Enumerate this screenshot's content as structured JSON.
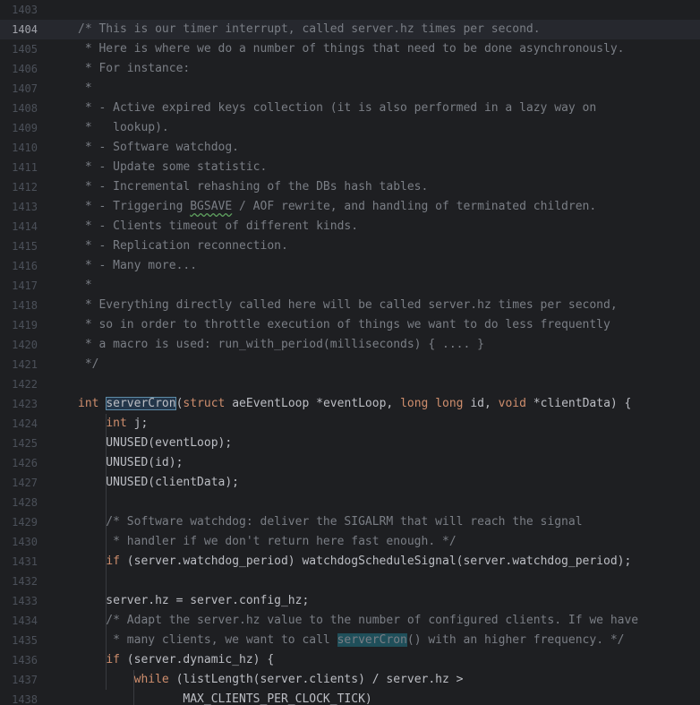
{
  "editor": {
    "current_line": "1404",
    "lines": [
      {
        "number": "1403",
        "tokens": []
      },
      {
        "number": "1404",
        "tokens": [
          {
            "t": "/* This is our timer interrupt, called server.hz times per second.",
            "c": "comment"
          }
        ]
      },
      {
        "number": "1405",
        "tokens": [
          {
            "t": " * Here is where we do a number of things that need to be done asynchronously.",
            "c": "comment"
          }
        ]
      },
      {
        "number": "1406",
        "tokens": [
          {
            "t": " * For instance:",
            "c": "comment"
          }
        ]
      },
      {
        "number": "1407",
        "tokens": [
          {
            "t": " *",
            "c": "comment"
          }
        ]
      },
      {
        "number": "1408",
        "tokens": [
          {
            "t": " * - Active expired keys collection (it is also performed in a lazy way on",
            "c": "comment"
          }
        ]
      },
      {
        "number": "1409",
        "tokens": [
          {
            "t": " *   lookup).",
            "c": "comment"
          }
        ]
      },
      {
        "number": "1410",
        "tokens": [
          {
            "t": " * - Software watchdog.",
            "c": "comment"
          }
        ]
      },
      {
        "number": "1411",
        "tokens": [
          {
            "t": " * - Update some statistic.",
            "c": "comment"
          }
        ]
      },
      {
        "number": "1412",
        "tokens": [
          {
            "t": " * - Incremental rehashing of the DBs hash tables.",
            "c": "comment"
          }
        ]
      },
      {
        "number": "1413",
        "tokens": [
          {
            "t": " * - Triggering ",
            "c": "comment"
          },
          {
            "t": "BGSAVE",
            "c": "comment warn"
          },
          {
            "t": " / AOF rewrite, and handling of terminated children.",
            "c": "comment"
          }
        ]
      },
      {
        "number": "1414",
        "tokens": [
          {
            "t": " * - Clients timeout of different kinds.",
            "c": "comment"
          }
        ]
      },
      {
        "number": "1415",
        "tokens": [
          {
            "t": " * - Replication reconnection.",
            "c": "comment"
          }
        ]
      },
      {
        "number": "1416",
        "tokens": [
          {
            "t": " * - Many more...",
            "c": "comment"
          }
        ]
      },
      {
        "number": "1417",
        "tokens": [
          {
            "t": " *",
            "c": "comment"
          }
        ]
      },
      {
        "number": "1418",
        "tokens": [
          {
            "t": " * Everything directly called here will be called server.hz times per second,",
            "c": "comment"
          }
        ]
      },
      {
        "number": "1419",
        "tokens": [
          {
            "t": " * so in order to throttle execution of things we want to do less frequently",
            "c": "comment"
          }
        ]
      },
      {
        "number": "1420",
        "tokens": [
          {
            "t": " * a macro is used: run_with_period(milliseconds) { .... }",
            "c": "comment"
          }
        ]
      },
      {
        "number": "1421",
        "tokens": [
          {
            "t": " */",
            "c": "comment"
          }
        ]
      },
      {
        "number": "1422",
        "tokens": []
      },
      {
        "number": "1423",
        "tokens": [
          {
            "t": "int ",
            "c": "keyword"
          },
          {
            "t": "serverCron",
            "c": "ident hl"
          },
          {
            "t": "(",
            "c": "ident"
          },
          {
            "t": "struct ",
            "c": "keyword"
          },
          {
            "t": "aeEventLoop *eventLoop, ",
            "c": "ident"
          },
          {
            "t": "long long ",
            "c": "keyword"
          },
          {
            "t": "id, ",
            "c": "ident"
          },
          {
            "t": "void ",
            "c": "keyword"
          },
          {
            "t": "*clientData) {",
            "c": "ident"
          }
        ]
      },
      {
        "number": "1424",
        "tokens": [
          {
            "t": "    ",
            "c": "ident"
          },
          {
            "t": "int ",
            "c": "keyword"
          },
          {
            "t": "j;",
            "c": "ident"
          }
        ]
      },
      {
        "number": "1425",
        "tokens": [
          {
            "t": "    UNUSED(eventLoop);",
            "c": "ident"
          }
        ]
      },
      {
        "number": "1426",
        "tokens": [
          {
            "t": "    UNUSED(id);",
            "c": "ident"
          }
        ]
      },
      {
        "number": "1427",
        "tokens": [
          {
            "t": "    UNUSED(clientData);",
            "c": "ident"
          }
        ]
      },
      {
        "number": "1428",
        "tokens": []
      },
      {
        "number": "1429",
        "tokens": [
          {
            "t": "    /* Software watchdog: deliver the SIGALRM that will reach the signal",
            "c": "comment"
          }
        ]
      },
      {
        "number": "1430",
        "tokens": [
          {
            "t": "     * handler if we don't return here fast enough. */",
            "c": "comment"
          }
        ]
      },
      {
        "number": "1431",
        "tokens": [
          {
            "t": "    ",
            "c": "ident"
          },
          {
            "t": "if ",
            "c": "keyword"
          },
          {
            "t": "(server.watchdog_period) watchdogScheduleSignal(server.watchdog_period);",
            "c": "ident"
          }
        ]
      },
      {
        "number": "1432",
        "tokens": []
      },
      {
        "number": "1433",
        "tokens": [
          {
            "t": "    server.hz = server.config_hz;",
            "c": "ident"
          }
        ]
      },
      {
        "number": "1434",
        "tokens": [
          {
            "t": "    /* Adapt the server.hz value to the number of configured clients. If we have",
            "c": "comment"
          }
        ]
      },
      {
        "number": "1435",
        "tokens": [
          {
            "t": "     * many clients, we want to call ",
            "c": "comment"
          },
          {
            "t": "serverCron",
            "c": "comment ref"
          },
          {
            "t": "() with an higher frequency. */",
            "c": "comment"
          }
        ]
      },
      {
        "number": "1436",
        "tokens": [
          {
            "t": "    ",
            "c": "ident"
          },
          {
            "t": "if ",
            "c": "keyword"
          },
          {
            "t": "(server.dynamic_hz) {",
            "c": "ident"
          }
        ]
      },
      {
        "number": "1437",
        "tokens": [
          {
            "t": "        ",
            "c": "ident"
          },
          {
            "t": "while ",
            "c": "keyword"
          },
          {
            "t": "(listLength(server.clients) / server.hz >",
            "c": "ident"
          }
        ]
      },
      {
        "number": "1438",
        "tokens": [
          {
            "t": "               MAX_CLIENTS_PER_CLOCK_TICK)",
            "c": "ident"
          }
        ]
      }
    ]
  }
}
